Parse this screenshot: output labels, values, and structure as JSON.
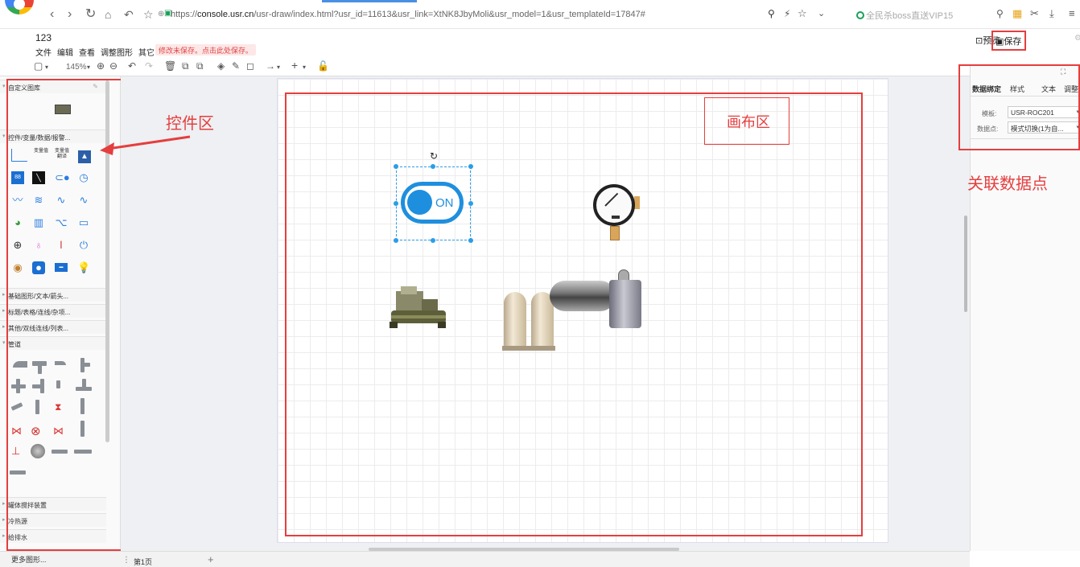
{
  "browser": {
    "url_prefix": "https://",
    "url_host": "console.usr.cn",
    "url_path": "/usr-draw/index.html?usr_id=11613&usr_link=XtNK8JbyMoli&usr_model=1&usr_templateId=17847#",
    "right_search": "全民杀boss直送VIP15"
  },
  "app": {
    "title": "123",
    "menu": [
      "文件",
      "编辑",
      "查看",
      "调整图形",
      "其它"
    ],
    "unsaved_notice": "修改未保存。点击此处保存。",
    "preview_label": "预览",
    "save_label": "保存",
    "zoom": "145%"
  },
  "left_panel": {
    "sections": {
      "custom": "自定义图库",
      "controls": "控件/变量/数据/报警...",
      "basic": "基础图形/文本/箭头...",
      "title_table": "标题/表格/连线/杂项...",
      "other": "其他/双线连线/列表...",
      "pipes": "管道",
      "mixer": "罐体搅拌装置",
      "cooling": "冷热源",
      "water": "给排水"
    },
    "control_items": {
      "var_value": "变量值",
      "var_switch": "变量值翻译"
    },
    "more_shapes": "更多图形..."
  },
  "annotations": {
    "control_area": "控件区",
    "canvas_area": "画布区",
    "data_binding": "关联数据点"
  },
  "canvas": {
    "switch_label": "ON"
  },
  "right_panel": {
    "tabs": [
      "数据绑定",
      "样式",
      "文本",
      "调整"
    ],
    "template_label": "模板:",
    "template_value": "USR-ROC201",
    "datapoint_label": "数据点:",
    "datapoint_value": "模式切换(1为自..."
  },
  "bottom": {
    "page_tab": "第1页"
  },
  "colors": {
    "highlight_red": "#e53e3e",
    "switch_blue": "#1e8fde"
  }
}
